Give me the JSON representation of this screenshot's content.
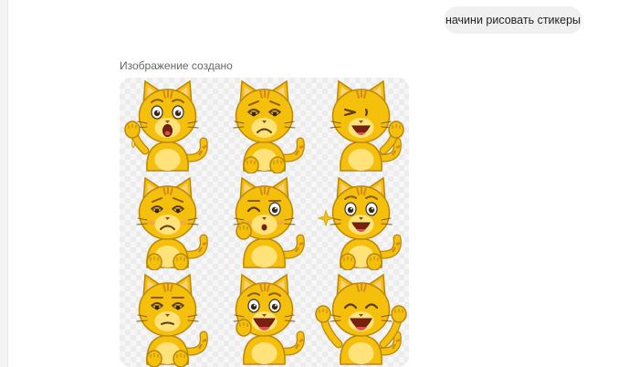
{
  "user_message": {
    "text": "начини рисовать стикеры"
  },
  "assistant": {
    "status_text": "Изображение создано"
  },
  "stickers": {
    "colors": {
      "fur": "#F5C00C",
      "outline": "#B8860B",
      "belly": "#FFE27A",
      "stripe": "#D48A1A"
    },
    "items": [
      {
        "name": "cat-sticker-surprised-wave"
      },
      {
        "name": "cat-sticker-sad-frown"
      },
      {
        "name": "cat-sticker-laughing-wave"
      },
      {
        "name": "cat-sticker-worried"
      },
      {
        "name": "cat-sticker-winking"
      },
      {
        "name": "cat-sticker-amazed-sparkle"
      },
      {
        "name": "cat-sticker-unimpressed"
      },
      {
        "name": "cat-sticker-shocked-cheek"
      },
      {
        "name": "cat-sticker-happy-cheering"
      }
    ]
  }
}
